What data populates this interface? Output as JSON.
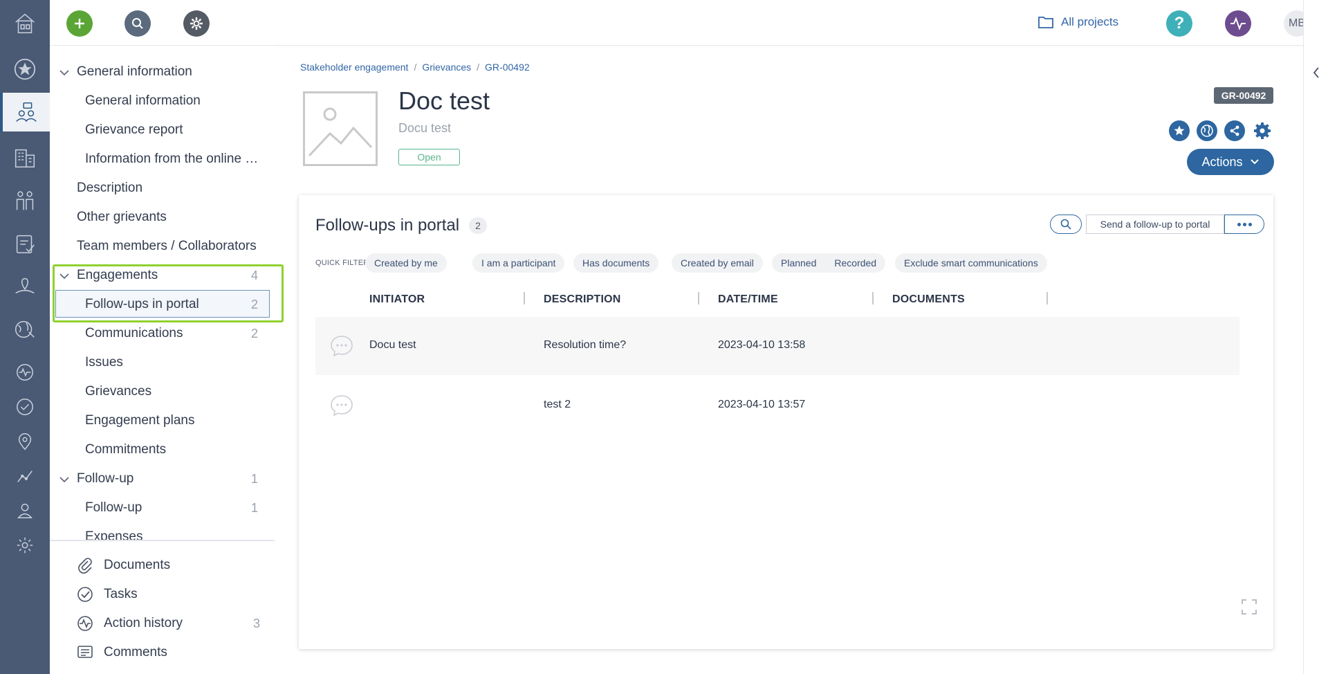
{
  "topbar": {
    "all_projects": "All projects",
    "avatar_initials": "MB",
    "colors": {
      "add": "#5aa536",
      "search": "#5b6a7c",
      "settings": "#555b65",
      "help": "#3fb0b8",
      "activity": "#6d4c8f"
    }
  },
  "rail": {
    "items": [
      "home-icon",
      "favorites-icon",
      "stakeholder-engagement-icon",
      "organizations-icon",
      "people-icon",
      "grievances-icon",
      "land-icon",
      "environment-icon",
      "activity-icon",
      "tasks-icon",
      "location-icon",
      "analytics-icon",
      "user-icon",
      "settings-icon"
    ]
  },
  "sidebar": {
    "sections": [
      {
        "label": "General information",
        "count": "",
        "children": [
          {
            "label": "General information",
            "count": ""
          },
          {
            "label": "Grievance report",
            "count": ""
          },
          {
            "label": "Information from the online …",
            "count": ""
          }
        ]
      },
      {
        "label": "Description",
        "count": ""
      },
      {
        "label": "Other grievants",
        "count": ""
      },
      {
        "label": "Team members / Collaborators",
        "count": ""
      },
      {
        "label": "Engagements",
        "count": "4",
        "children": [
          {
            "label": "Follow-ups in portal",
            "count": "2"
          },
          {
            "label": "Communications",
            "count": "2"
          },
          {
            "label": "Issues",
            "count": ""
          },
          {
            "label": "Grievances",
            "count": ""
          },
          {
            "label": "Engagement plans",
            "count": ""
          },
          {
            "label": "Commitments",
            "count": ""
          }
        ]
      },
      {
        "label": "Follow-up",
        "count": "1",
        "children": [
          {
            "label": "Follow-up",
            "count": "1"
          },
          {
            "label": "Expenses",
            "count": ""
          }
        ]
      }
    ],
    "bottom": [
      {
        "label": "Documents",
        "count": "",
        "icon": "paperclip-icon"
      },
      {
        "label": "Tasks",
        "count": "",
        "icon": "check-circle-icon"
      },
      {
        "label": "Action history",
        "count": "3",
        "icon": "activity-icon"
      },
      {
        "label": "Comments",
        "count": "",
        "icon": "comment-icon"
      }
    ]
  },
  "breadcrumb": [
    "Stakeholder engagement",
    "Grievances",
    "GR-00492"
  ],
  "record": {
    "title": "Doc test",
    "subtitle": "Docu test",
    "status": "Open",
    "id": "GR-00492",
    "actions_label": "Actions"
  },
  "card": {
    "title": "Follow-ups in portal",
    "count": "2",
    "send_label": "Send a follow-up to portal",
    "quick_filters_label": "QUICK FILTERS:",
    "quick_filters": [
      "Created by me",
      "I am a participant",
      "Has documents",
      "Created by email",
      "Planned",
      "Recorded",
      "Exclude smart communications"
    ],
    "columns": [
      "INITIATOR",
      "DESCRIPTION",
      "DATE/TIME",
      "DOCUMENTS"
    ],
    "rows": [
      {
        "initiator": "Docu test",
        "description": "Resolution time?",
        "datetime": "2023-04-10 13:58",
        "documents": ""
      },
      {
        "initiator": "",
        "description": "test 2",
        "datetime": "2023-04-10 13:57",
        "documents": ""
      }
    ]
  }
}
